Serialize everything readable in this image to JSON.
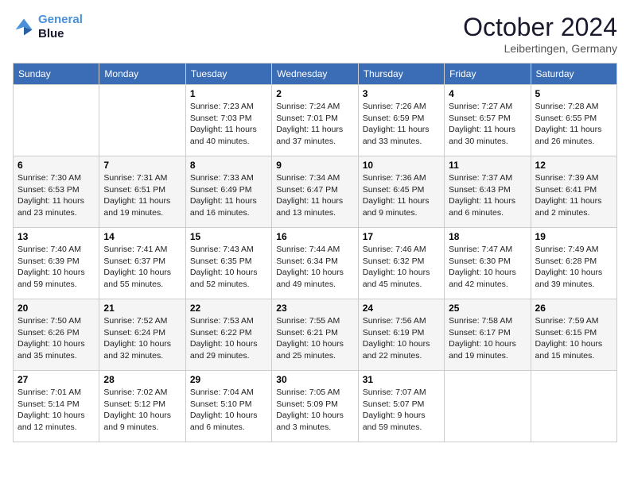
{
  "header": {
    "logo_line1": "General",
    "logo_line2": "Blue",
    "month": "October 2024",
    "location": "Leibertingen, Germany"
  },
  "weekdays": [
    "Sunday",
    "Monday",
    "Tuesday",
    "Wednesday",
    "Thursday",
    "Friday",
    "Saturday"
  ],
  "weeks": [
    [
      {
        "day": "",
        "sunrise": "",
        "sunset": "",
        "daylight": ""
      },
      {
        "day": "",
        "sunrise": "",
        "sunset": "",
        "daylight": ""
      },
      {
        "day": "1",
        "sunrise": "Sunrise: 7:23 AM",
        "sunset": "Sunset: 7:03 PM",
        "daylight": "Daylight: 11 hours and 40 minutes."
      },
      {
        "day": "2",
        "sunrise": "Sunrise: 7:24 AM",
        "sunset": "Sunset: 7:01 PM",
        "daylight": "Daylight: 11 hours and 37 minutes."
      },
      {
        "day": "3",
        "sunrise": "Sunrise: 7:26 AM",
        "sunset": "Sunset: 6:59 PM",
        "daylight": "Daylight: 11 hours and 33 minutes."
      },
      {
        "day": "4",
        "sunrise": "Sunrise: 7:27 AM",
        "sunset": "Sunset: 6:57 PM",
        "daylight": "Daylight: 11 hours and 30 minutes."
      },
      {
        "day": "5",
        "sunrise": "Sunrise: 7:28 AM",
        "sunset": "Sunset: 6:55 PM",
        "daylight": "Daylight: 11 hours and 26 minutes."
      }
    ],
    [
      {
        "day": "6",
        "sunrise": "Sunrise: 7:30 AM",
        "sunset": "Sunset: 6:53 PM",
        "daylight": "Daylight: 11 hours and 23 minutes."
      },
      {
        "day": "7",
        "sunrise": "Sunrise: 7:31 AM",
        "sunset": "Sunset: 6:51 PM",
        "daylight": "Daylight: 11 hours and 19 minutes."
      },
      {
        "day": "8",
        "sunrise": "Sunrise: 7:33 AM",
        "sunset": "Sunset: 6:49 PM",
        "daylight": "Daylight: 11 hours and 16 minutes."
      },
      {
        "day": "9",
        "sunrise": "Sunrise: 7:34 AM",
        "sunset": "Sunset: 6:47 PM",
        "daylight": "Daylight: 11 hours and 13 minutes."
      },
      {
        "day": "10",
        "sunrise": "Sunrise: 7:36 AM",
        "sunset": "Sunset: 6:45 PM",
        "daylight": "Daylight: 11 hours and 9 minutes."
      },
      {
        "day": "11",
        "sunrise": "Sunrise: 7:37 AM",
        "sunset": "Sunset: 6:43 PM",
        "daylight": "Daylight: 11 hours and 6 minutes."
      },
      {
        "day": "12",
        "sunrise": "Sunrise: 7:39 AM",
        "sunset": "Sunset: 6:41 PM",
        "daylight": "Daylight: 11 hours and 2 minutes."
      }
    ],
    [
      {
        "day": "13",
        "sunrise": "Sunrise: 7:40 AM",
        "sunset": "Sunset: 6:39 PM",
        "daylight": "Daylight: 10 hours and 59 minutes."
      },
      {
        "day": "14",
        "sunrise": "Sunrise: 7:41 AM",
        "sunset": "Sunset: 6:37 PM",
        "daylight": "Daylight: 10 hours and 55 minutes."
      },
      {
        "day": "15",
        "sunrise": "Sunrise: 7:43 AM",
        "sunset": "Sunset: 6:35 PM",
        "daylight": "Daylight: 10 hours and 52 minutes."
      },
      {
        "day": "16",
        "sunrise": "Sunrise: 7:44 AM",
        "sunset": "Sunset: 6:34 PM",
        "daylight": "Daylight: 10 hours and 49 minutes."
      },
      {
        "day": "17",
        "sunrise": "Sunrise: 7:46 AM",
        "sunset": "Sunset: 6:32 PM",
        "daylight": "Daylight: 10 hours and 45 minutes."
      },
      {
        "day": "18",
        "sunrise": "Sunrise: 7:47 AM",
        "sunset": "Sunset: 6:30 PM",
        "daylight": "Daylight: 10 hours and 42 minutes."
      },
      {
        "day": "19",
        "sunrise": "Sunrise: 7:49 AM",
        "sunset": "Sunset: 6:28 PM",
        "daylight": "Daylight: 10 hours and 39 minutes."
      }
    ],
    [
      {
        "day": "20",
        "sunrise": "Sunrise: 7:50 AM",
        "sunset": "Sunset: 6:26 PM",
        "daylight": "Daylight: 10 hours and 35 minutes."
      },
      {
        "day": "21",
        "sunrise": "Sunrise: 7:52 AM",
        "sunset": "Sunset: 6:24 PM",
        "daylight": "Daylight: 10 hours and 32 minutes."
      },
      {
        "day": "22",
        "sunrise": "Sunrise: 7:53 AM",
        "sunset": "Sunset: 6:22 PM",
        "daylight": "Daylight: 10 hours and 29 minutes."
      },
      {
        "day": "23",
        "sunrise": "Sunrise: 7:55 AM",
        "sunset": "Sunset: 6:21 PM",
        "daylight": "Daylight: 10 hours and 25 minutes."
      },
      {
        "day": "24",
        "sunrise": "Sunrise: 7:56 AM",
        "sunset": "Sunset: 6:19 PM",
        "daylight": "Daylight: 10 hours and 22 minutes."
      },
      {
        "day": "25",
        "sunrise": "Sunrise: 7:58 AM",
        "sunset": "Sunset: 6:17 PM",
        "daylight": "Daylight: 10 hours and 19 minutes."
      },
      {
        "day": "26",
        "sunrise": "Sunrise: 7:59 AM",
        "sunset": "Sunset: 6:15 PM",
        "daylight": "Daylight: 10 hours and 15 minutes."
      }
    ],
    [
      {
        "day": "27",
        "sunrise": "Sunrise: 7:01 AM",
        "sunset": "Sunset: 5:14 PM",
        "daylight": "Daylight: 10 hours and 12 minutes."
      },
      {
        "day": "28",
        "sunrise": "Sunrise: 7:02 AM",
        "sunset": "Sunset: 5:12 PM",
        "daylight": "Daylight: 10 hours and 9 minutes."
      },
      {
        "day": "29",
        "sunrise": "Sunrise: 7:04 AM",
        "sunset": "Sunset: 5:10 PM",
        "daylight": "Daylight: 10 hours and 6 minutes."
      },
      {
        "day": "30",
        "sunrise": "Sunrise: 7:05 AM",
        "sunset": "Sunset: 5:09 PM",
        "daylight": "Daylight: 10 hours and 3 minutes."
      },
      {
        "day": "31",
        "sunrise": "Sunrise: 7:07 AM",
        "sunset": "Sunset: 5:07 PM",
        "daylight": "Daylight: 9 hours and 59 minutes."
      },
      {
        "day": "",
        "sunrise": "",
        "sunset": "",
        "daylight": ""
      },
      {
        "day": "",
        "sunrise": "",
        "sunset": "",
        "daylight": ""
      }
    ]
  ]
}
